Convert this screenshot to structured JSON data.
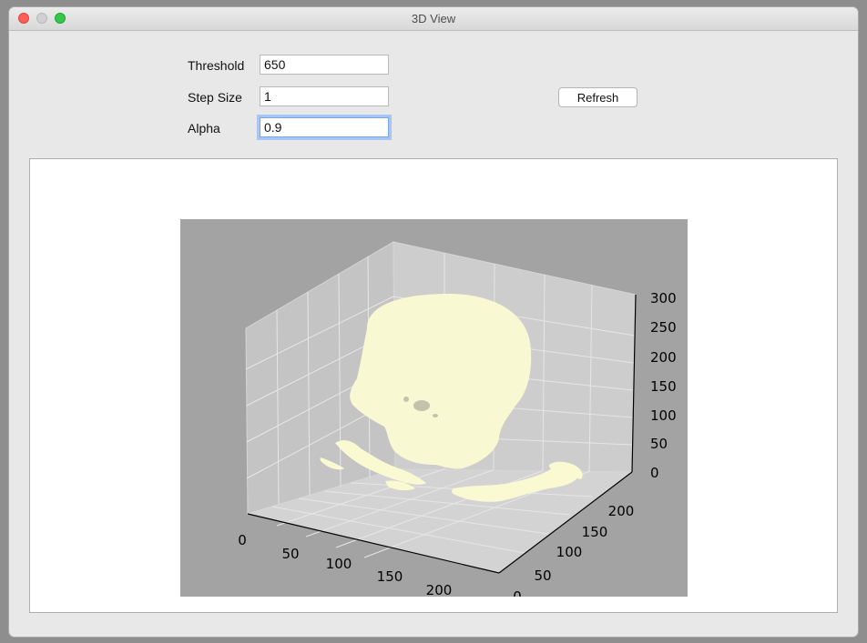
{
  "window": {
    "title": "3D View"
  },
  "controls": {
    "threshold": {
      "label": "Threshold",
      "value": "650"
    },
    "step_size": {
      "label": "Step Size",
      "value": "1"
    },
    "alpha": {
      "label": "Alpha",
      "value": "0.9"
    },
    "refresh_label": "Refresh"
  },
  "chart_data": {
    "type": "scatter",
    "projection": "3d",
    "description_colors": {
      "surface": "#fafad2",
      "pane": "#cfcfcf",
      "background": "#a3a3a3"
    },
    "x_ticks": [
      "0",
      "50",
      "100",
      "150",
      "200"
    ],
    "y_ticks": [
      "0",
      "50",
      "100",
      "150",
      "200"
    ],
    "z_ticks": [
      "0",
      "50",
      "100",
      "150",
      "200",
      "250",
      "300"
    ],
    "xlim": [
      0,
      250
    ],
    "ylim": [
      0,
      250
    ],
    "zlim": [
      0,
      310
    ],
    "grid": true
  }
}
